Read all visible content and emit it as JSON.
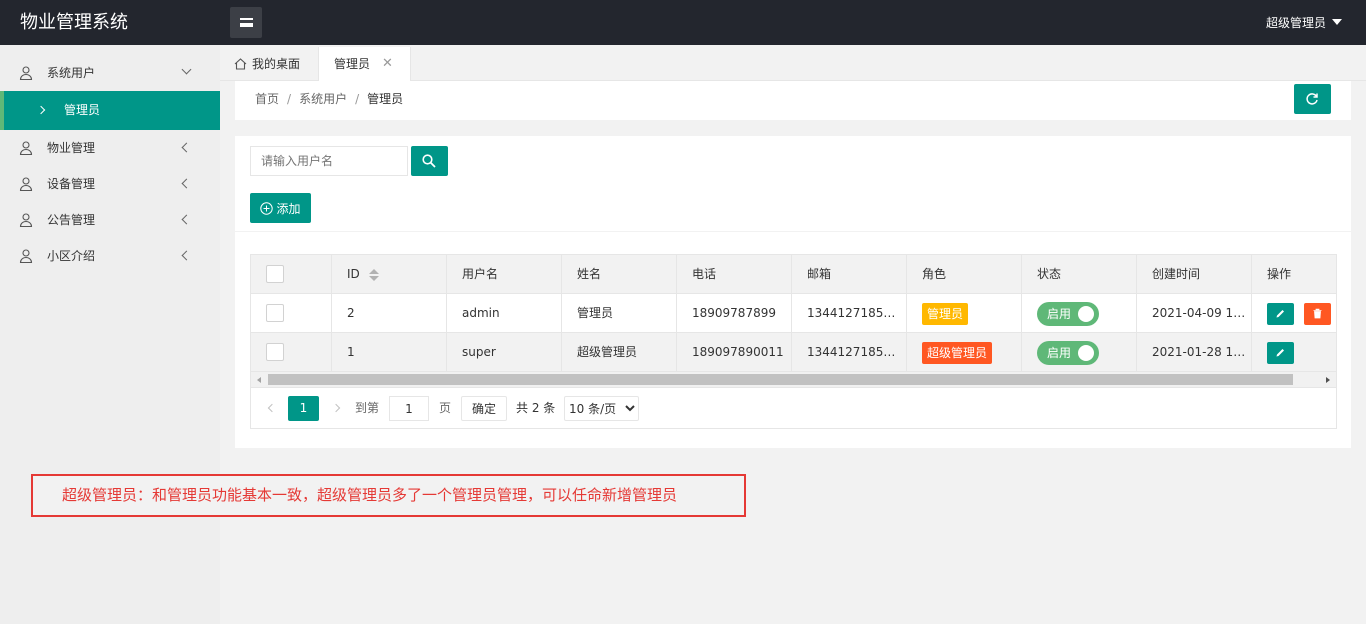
{
  "app": {
    "title": "物业管理系统"
  },
  "header": {
    "user": "超级管理员"
  },
  "sidebar": {
    "items": [
      {
        "label": "系统用户",
        "expanded": true,
        "children": [
          {
            "label": "管理员",
            "active": true
          }
        ]
      },
      {
        "label": "物业管理"
      },
      {
        "label": "设备管理"
      },
      {
        "label": "公告管理"
      },
      {
        "label": "小区介绍"
      }
    ]
  },
  "tabs": {
    "home": "我的桌面",
    "active": "管理员"
  },
  "breadcrumb": [
    "首页",
    "系统用户",
    "管理员"
  ],
  "search": {
    "placeholder": "请输入用户名",
    "value": ""
  },
  "toolbar": {
    "add_label": "添加"
  },
  "table": {
    "columns": [
      "ID",
      "用户名",
      "姓名",
      "电话",
      "邮箱",
      "角色",
      "状态",
      "创建时间",
      "操作"
    ],
    "rows": [
      {
        "id": "2",
        "username": "admin",
        "name": "管理员",
        "phone": "18909787899",
        "email": "1344127185…",
        "role": "管理员",
        "role_color": "#ffb800",
        "status": "启用",
        "created": "2021-04-09 1…",
        "can_delete": true
      },
      {
        "id": "1",
        "username": "super",
        "name": "超级管理员",
        "phone": "189097890011",
        "email": "1344127185…",
        "role": "超级管理员",
        "role_color": "#ff5722",
        "status": "启用",
        "created": "2021-01-28 1…",
        "can_delete": false
      }
    ]
  },
  "pagination": {
    "current": "1",
    "goto_label": "到第",
    "goto_value": "1",
    "page_unit": "页",
    "confirm": "确定",
    "total": "共 2 条",
    "page_size": "10 条/页"
  },
  "note": "超级管理员：和管理员功能基本一致，超级管理员多了一个管理员管理，可以任命新增管理员",
  "colors": {
    "primary": "#009688",
    "header": "#23262e",
    "danger": "#ff5722",
    "warn": "#ffb800",
    "switch_on": "#5fb878"
  }
}
